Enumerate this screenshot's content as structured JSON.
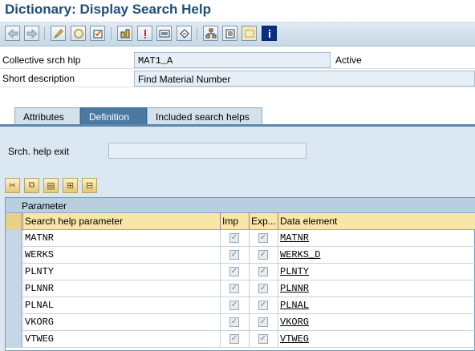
{
  "window": {
    "title": "Dictionary: Display Search Help"
  },
  "toolbar": {
    "icons": [
      "back-arrow-icon",
      "forward-arrow-icon",
      "display-change-icon",
      "other-object-icon",
      "check-icon",
      "activate-icon",
      "where-used-icon",
      "information-icon",
      "display-object-list-icon",
      "navigate-icon",
      "hierarchy-icon",
      "print-icon",
      "layout-icon",
      "info-icon"
    ]
  },
  "header": {
    "collective_label": "Collective srch hlp",
    "collective_value": "MAT1_A",
    "status": "Active",
    "short_desc_label": "Short description",
    "short_desc_value": "Find Material Number"
  },
  "tabs": [
    {
      "label": "Attributes",
      "active": false
    },
    {
      "label": "Definition",
      "active": true
    },
    {
      "label": "Included search helps",
      "active": false
    }
  ],
  "definition": {
    "exit_label": "Srch. help exit",
    "exit_value": ""
  },
  "table": {
    "caption": "Parameter",
    "headers": {
      "param": "Search help parameter",
      "imp": "Imp",
      "exp": "Exp...",
      "data_element": "Data element"
    },
    "rows": [
      {
        "param": "MATNR",
        "imp": true,
        "exp": true,
        "data_element": "MATNR"
      },
      {
        "param": "WERKS",
        "imp": true,
        "exp": true,
        "data_element": "WERKS_D"
      },
      {
        "param": "PLNTY",
        "imp": true,
        "exp": true,
        "data_element": "PLNTY"
      },
      {
        "param": "PLNNR",
        "imp": true,
        "exp": true,
        "data_element": "PLNNR"
      },
      {
        "param": "PLNAL",
        "imp": true,
        "exp": true,
        "data_element": "PLNAL"
      },
      {
        "param": "VKORG",
        "imp": true,
        "exp": true,
        "data_element": "VKORG"
      },
      {
        "param": "VTWEG",
        "imp": true,
        "exp": true,
        "data_element": "VTWEG"
      }
    ]
  }
}
